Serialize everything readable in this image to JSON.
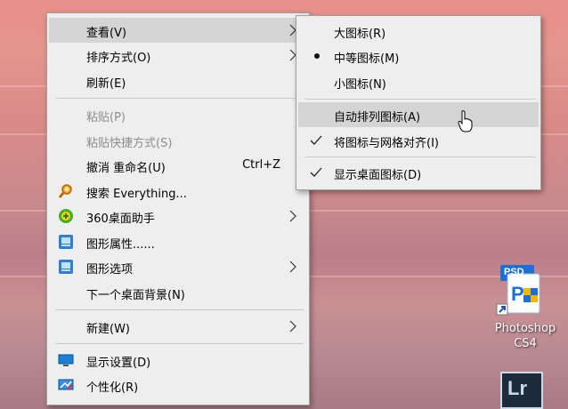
{
  "context_menu": {
    "items": [
      {
        "label": "查看(V)"
      },
      {
        "label": "排序方式(O)"
      },
      {
        "label": "刷新(E)"
      },
      {
        "label": "粘贴(P)"
      },
      {
        "label": "粘贴快捷方式(S)"
      },
      {
        "label": "撤消 重命名(U)",
        "accelerator": "Ctrl+Z"
      },
      {
        "label": "搜索 Everything...",
        "icon": "everything-search-icon"
      },
      {
        "label": "360桌面助手",
        "icon": "360-assistant-icon"
      },
      {
        "label": "图形属性......",
        "icon": "intel-graphics-icon"
      },
      {
        "label": "图形选项",
        "icon": "intel-graphics-icon"
      },
      {
        "label": "下一个桌面背景(N)"
      },
      {
        "label": "新建(W)"
      },
      {
        "label": "显示设置(D)",
        "icon": "display-icon"
      },
      {
        "label": "个性化(R)",
        "icon": "personalize-icon"
      }
    ]
  },
  "view_submenu": {
    "items": [
      {
        "label": "大图标(R)"
      },
      {
        "label": "中等图标(M)",
        "selected": true
      },
      {
        "label": "小图标(N)"
      },
      {
        "label": "自动排列图标(A)"
      },
      {
        "label": "将图标与网格对齐(I)",
        "checked": true
      },
      {
        "label": "显示桌面图标(D)",
        "checked": true
      }
    ]
  },
  "desktop_icons": [
    {
      "label_line1": "Photoshop",
      "label_line2": "CS4",
      "badge": "PSD",
      "icon": "photoshop-icon"
    },
    {
      "badge": "Lr",
      "icon": "lightroom-icon"
    }
  ],
  "colors": {
    "menu_bg": "#eeeeee",
    "highlight": "#d4d4d4",
    "disabled_text": "#8c8c8c",
    "ps_blue": "#1c6fd6"
  }
}
